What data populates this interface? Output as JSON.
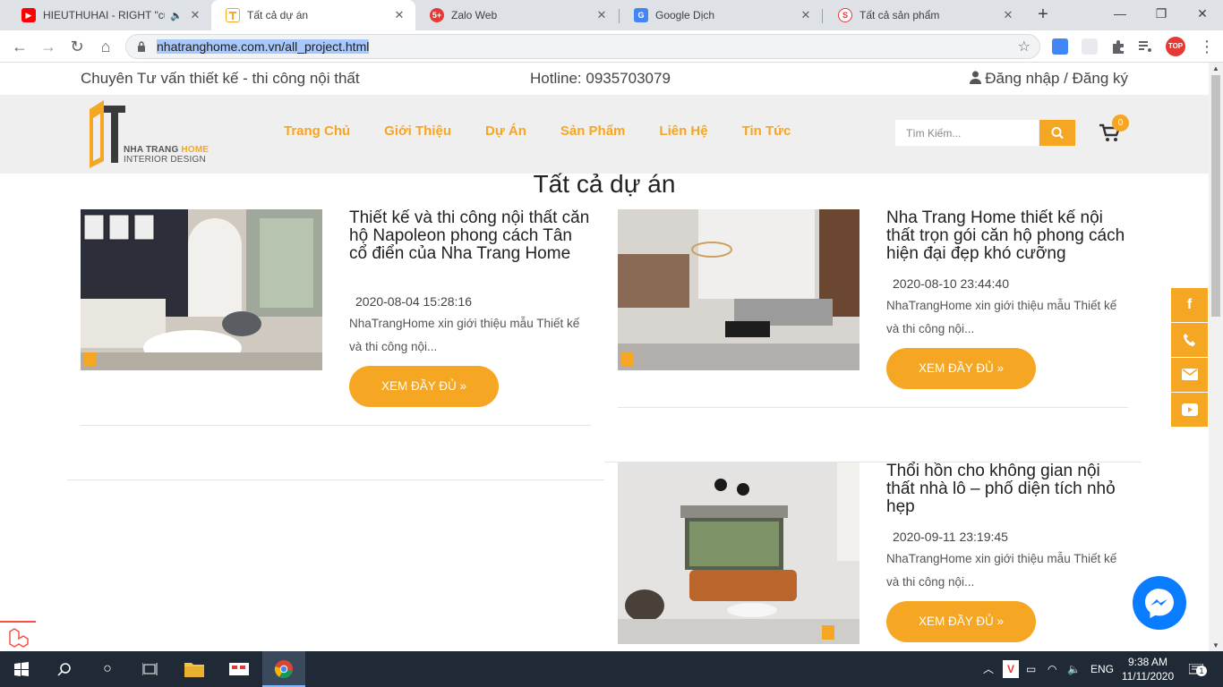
{
  "browser": {
    "tabs": [
      {
        "title": "HIEUTHUHAI - RIGHT \"cuộ",
        "icon": "youtube-icon",
        "audio": "🔈"
      },
      {
        "title": "Tất cả dự án",
        "icon": "site-favicon"
      },
      {
        "title": "Zalo Web",
        "icon": "zalo-icon",
        "badge": "5+"
      },
      {
        "title": "Google Dịch",
        "icon": "google-translate-icon"
      },
      {
        "title": "Tất cả sản phẩm",
        "icon": "site-favicon"
      }
    ],
    "url": "nhatranghome.com.vn/all_project.html"
  },
  "site": {
    "slogan": "Chuyên Tư vấn thiết kế - thi công nội thất",
    "hotline": "Hotline: 0935703079",
    "login": "Đăng nhập / Đăng ký",
    "logo": {
      "brand": "NHA TRANG",
      "brand_accent": "HOME",
      "sub": "INTERIOR DESIGN"
    },
    "menu": [
      "Trang Chủ",
      "Giới Thiệu",
      "Dự Án",
      "Sản Phẩm",
      "Liên Hệ",
      "Tin Tức"
    ],
    "search_placeholder": "Tìm Kiếm...",
    "cart_count": "0",
    "accent_color": "#f5a623"
  },
  "page_title": "Tất cả dự án",
  "projects": [
    {
      "title": "Thiết kế và thi công nội thất căn hộ Napoleon phong cách Tân cổ điển của Nha Trang Home",
      "date": "2020-08-04 15:28:16",
      "desc": "NhaTrangHome xin giới thiệu mẫu Thiết kế và thi công nội...",
      "button": "XEM ĐẦY ĐỦ »"
    },
    {
      "title": "Nha Trang Home thiết kế nội thất trọn gói căn hộ phong cách hiện đại đẹp khó cưỡng",
      "date": "2020-08-10 23:44:40",
      "desc": "NhaTrangHome xin giới thiệu mẫu Thiết kế và thi công nội...",
      "button": "XEM ĐẦY ĐỦ »"
    },
    {
      "title": "Thổi hồn cho không gian nội thất nhà lô – phố diện tích nhỏ hẹp",
      "date": "2020-09-11 23:19:45",
      "desc": "NhaTrangHome xin giới thiệu mẫu Thiết kế và thi công nội...",
      "button": "XEM ĐẦY ĐỦ »"
    }
  ],
  "social": [
    "facebook-icon",
    "phone-icon",
    "email-icon",
    "youtube-icon"
  ],
  "taskbar": {
    "lang": "ENG",
    "time": "9:38 AM",
    "date": "11/11/2020",
    "notif_count": "1"
  }
}
